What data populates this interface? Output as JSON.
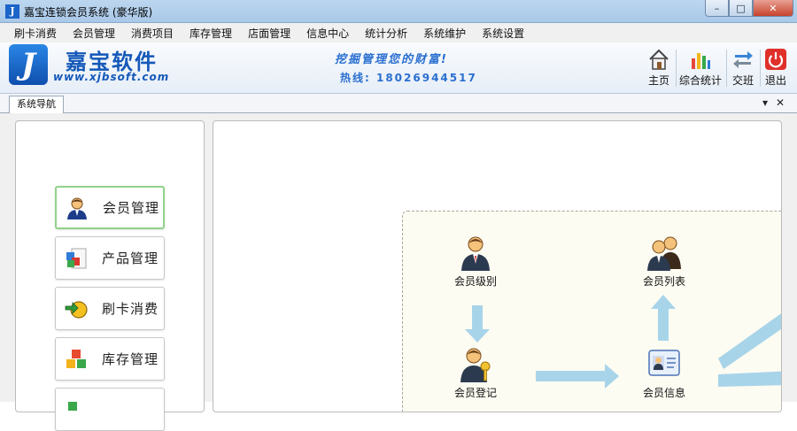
{
  "window": {
    "title": "嘉宝连锁会员系统 (豪华版)",
    "app_icon_letter": "J",
    "minimize": "–",
    "maximize": "□",
    "close": "✕"
  },
  "menu": [
    "刷卡消费",
    "会员管理",
    "消费项目",
    "库存管理",
    "店面管理",
    "信息中心",
    "统计分析",
    "系统维护",
    "系统设置"
  ],
  "header": {
    "logo_letter": "J",
    "brand_name": "嘉宝软件",
    "brand_url": "www.xjbsoft.com",
    "slogan": "挖掘管理您的财富!",
    "hotline": "热线: 18026944517"
  },
  "toolbar": {
    "home": "主页",
    "stats": "综合统计",
    "shift": "交班",
    "exit": "退出"
  },
  "tabs": {
    "active": "系统导航",
    "dropdown_glyph": "▾",
    "close_glyph": "✕"
  },
  "nav": [
    "会员管理",
    "产品管理",
    "刷卡消费",
    "库存管理"
  ],
  "flow": {
    "member_level": "会员级别",
    "member_list": "会员列表",
    "member_register": "会员登记",
    "member_info": "会员信息"
  },
  "colors": {
    "accent": "#1458b8",
    "active_nav_border": "#90d38a",
    "arrow": "#a8d4ea",
    "flow_bg": "#fdfcf2"
  },
  "icons": {
    "toolbar": [
      "home-icon",
      "bar-chart-icon",
      "swap-arrows-icon",
      "power-icon"
    ],
    "nav": [
      "user-icon",
      "product-cubes-icon",
      "card-swipe-icon",
      "inventory-cubes-icon"
    ],
    "flow": [
      "user-icon",
      "users-group-icon",
      "user-key-icon",
      "id-card-icon"
    ]
  }
}
